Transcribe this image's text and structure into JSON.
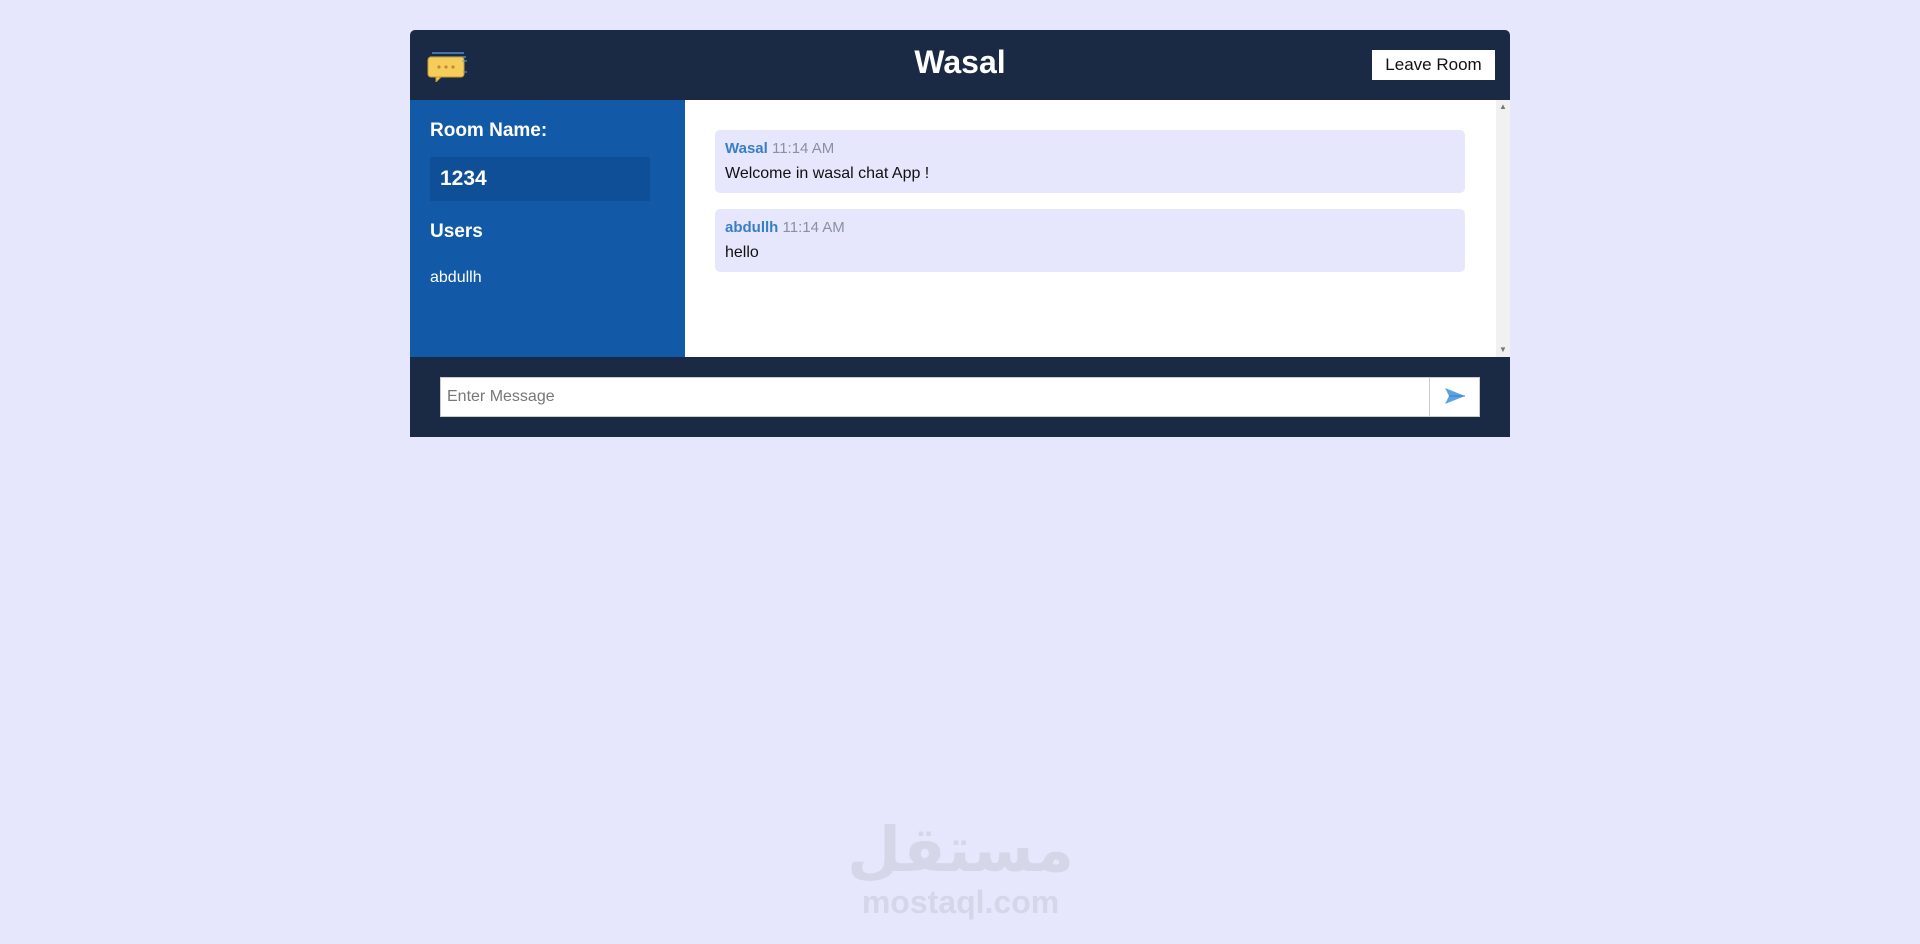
{
  "header": {
    "title": "Wasal",
    "leave_label": "Leave Room",
    "logo_icon": "chat-bubble-icon"
  },
  "sidebar": {
    "room_heading": "Room Name:",
    "room_name": "1234",
    "users_heading": "Users",
    "users": [
      "abdullh"
    ]
  },
  "messages": [
    {
      "author": "Wasal",
      "time": "11:14 AM",
      "text": "Welcome in wasal chat App !"
    },
    {
      "author": "abdullh",
      "time": "11:14 AM",
      "text": "hello"
    }
  ],
  "form": {
    "placeholder": "Enter Message",
    "value": "",
    "send_icon": "paper-plane-icon"
  },
  "watermark": {
    "arabic": "مستقل",
    "latin": "mostaql.com"
  },
  "colors": {
    "page_background": "#e6e7fc",
    "header_background": "#1b2a44",
    "sidebar_background": "#125aa8",
    "room_box_background": "#0f4f98",
    "message_background": "#e6e7fc",
    "author_color": "#3a7fc4",
    "time_color": "#8a8fa6",
    "logo_yellow": "#f5cd5b",
    "send_icon_color": "#5aa3e0"
  }
}
